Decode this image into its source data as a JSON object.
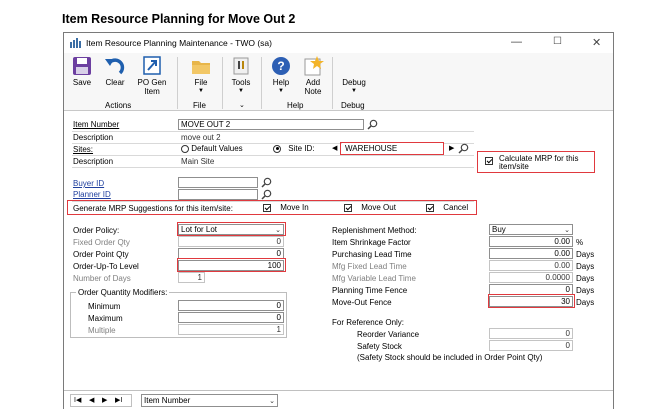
{
  "page_title": "Item Resource Planning for Move Out 2",
  "window": {
    "title": "Item Resource Planning Maintenance  -  TWO (sa)",
    "minimize": "—",
    "maximize": "☐",
    "close": "✕"
  },
  "ribbon": {
    "save": "Save",
    "clear": "Clear",
    "po_gen_1": "PO Gen",
    "po_gen_2": "Item",
    "file": "File",
    "tools": "Tools",
    "help": "Help",
    "add_note_1": "Add",
    "add_note_2": "Note",
    "debug": "Debug",
    "groups": {
      "actions": "Actions",
      "file": "File",
      "help": "Help",
      "debug": "Debug"
    }
  },
  "header": {
    "item_number_label": "Item Number",
    "item_number": "MOVE OUT 2",
    "description_label": "Description",
    "description": "move out 2",
    "sites_label": "Sites:",
    "default_values": "Default Values",
    "site_id_label": "Site ID:",
    "site_id": "WAREHOUSE",
    "site_description_label": "Description",
    "site_description": "Main Site",
    "calc_mrp": "Calculate MRP for this item/site",
    "buyer_id_label": "Buyer ID",
    "planner_id_label": "Planner ID",
    "generate_label": "Generate MRP Suggestions for this item/site:",
    "move_in": "Move In",
    "move_out": "Move Out",
    "cancel": "Cancel"
  },
  "left": {
    "order_policy_label": "Order Policy:",
    "order_policy": "Lot for Lot",
    "fixed_order_qty_label": "Fixed Order Qty",
    "fixed_order_qty": "0",
    "order_point_qty_label": "Order Point Qty",
    "order_point_qty": "0",
    "order_up_to_label": "Order-Up-To Level",
    "order_up_to": "100",
    "number_of_days_label": "Number of Days",
    "number_of_days": "1",
    "modifiers_title": "Order Quantity Modifiers:",
    "minimum_label": "Minimum",
    "minimum": "0",
    "maximum_label": "Maximum",
    "maximum": "0",
    "multiple_label": "Multiple",
    "multiple": "1"
  },
  "right": {
    "replenishment_label": "Replenishment Method:",
    "replenishment": "Buy",
    "shrinkage_label": "Item Shrinkage Factor",
    "shrinkage": "0.00",
    "shrinkage_unit": "%",
    "purchasing_label": "Purchasing Lead Time",
    "purchasing": "0.00",
    "mfg_fixed_label": "Mfg Fixed Lead Time",
    "mfg_fixed": "0.00",
    "mfg_variable_label": "Mfg Variable Lead Time",
    "mfg_variable": "0.0000",
    "planning_fence_label": "Planning Time Fence",
    "planning_fence": "0",
    "move_out_fence_label": "Move-Out Fence",
    "move_out_fence": "30",
    "days": "Days",
    "reference_title": "For Reference Only:",
    "reorder_variance_label": "Reorder Variance",
    "reorder_variance": "0",
    "safety_stock_label": "Safety Stock",
    "safety_stock": "0",
    "safety_note": "(Safety Stock should be included in Order Point Qty)"
  },
  "navbar": {
    "first": "I◀",
    "prev": "◀",
    "next": "▶",
    "last": "▶I",
    "sort": "Item Number"
  }
}
